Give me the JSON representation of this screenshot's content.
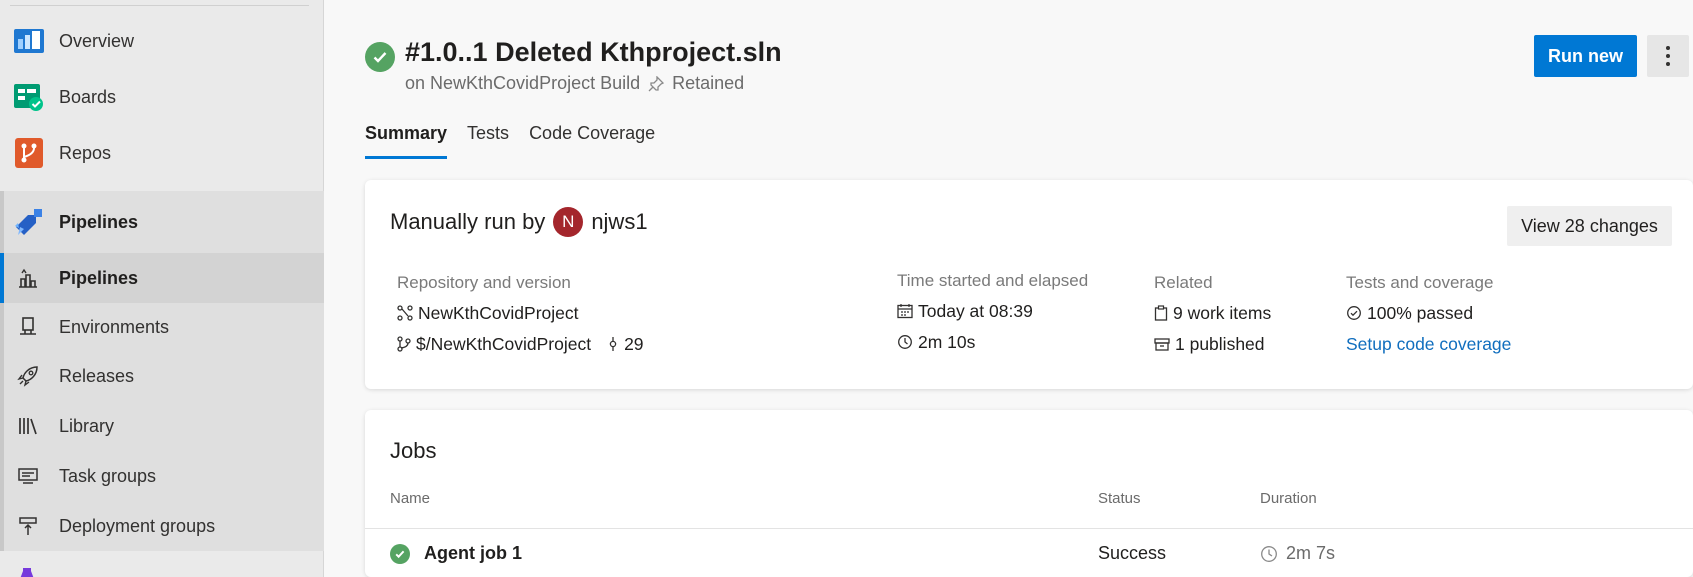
{
  "sidebar": {
    "items": [
      {
        "label": "Overview",
        "icon": "overview-icon"
      },
      {
        "label": "Boards",
        "icon": "boards-icon"
      },
      {
        "label": "Repos",
        "icon": "repos-icon"
      },
      {
        "label": "Pipelines",
        "icon": "pipelines-icon"
      },
      {
        "label": "Pipelines",
        "icon": "pipelines-sub-icon"
      },
      {
        "label": "Environments",
        "icon": "environments-icon"
      },
      {
        "label": "Releases",
        "icon": "rocket-icon"
      },
      {
        "label": "Library",
        "icon": "library-icon"
      },
      {
        "label": "Task groups",
        "icon": "task-groups-icon"
      },
      {
        "label": "Deployment groups",
        "icon": "deployment-groups-icon"
      }
    ]
  },
  "header": {
    "title": "#1.0..1 Deleted Kthproject.sln",
    "subtitle": "on NewKthCovidProject Build",
    "retained": "Retained",
    "run_new": "Run new"
  },
  "tabs": [
    "Summary",
    "Tests",
    "Code Coverage"
  ],
  "summary": {
    "manually_run_by": "Manually run by",
    "avatar_initial": "N",
    "user": "njws1",
    "view_changes": "View 28 changes",
    "repository": {
      "heading": "Repository and version",
      "repo": "NewKthCovidProject",
      "path": "$/NewKthCovidProject",
      "changeset": "29"
    },
    "time": {
      "heading": "Time started and elapsed",
      "started": "Today at 08:39",
      "elapsed": "2m 10s"
    },
    "related": {
      "heading": "Related",
      "work_items": "9 work items",
      "published": "1 published"
    },
    "tests": {
      "heading": "Tests and coverage",
      "passed": "100% passed",
      "setup_link": "Setup code coverage"
    }
  },
  "jobs": {
    "title": "Jobs",
    "columns": [
      "Name",
      "Status",
      "Duration"
    ],
    "rows": [
      {
        "name": "Agent job 1",
        "status": "Success",
        "duration": "2m 7s"
      }
    ]
  },
  "colors": {
    "accent": "#0078d4",
    "success": "#55a362",
    "avatar": "#a4262c"
  }
}
